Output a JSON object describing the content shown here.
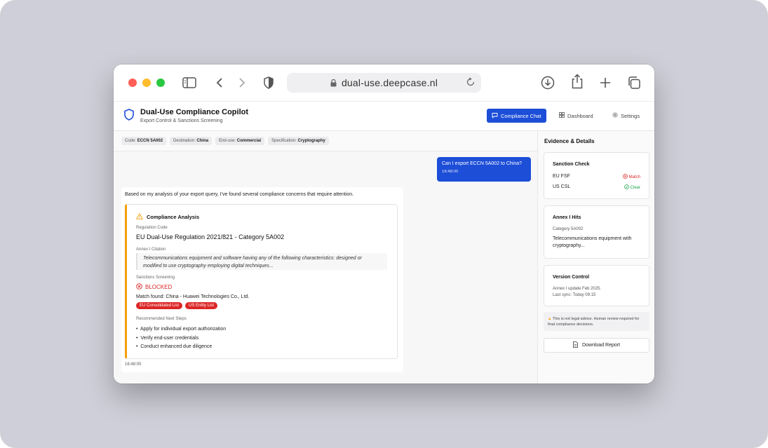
{
  "browser": {
    "url": "dual-use.deepcase.nl"
  },
  "app": {
    "title": "Dual-Use Compliance Copilot",
    "subtitle": "Export Control & Sanctions Screening"
  },
  "nav": {
    "chat": "Compliance Chat",
    "dashboard": "Dashboard",
    "settings": "Settings"
  },
  "chips": [
    {
      "key": "Code:",
      "value": "ECCN 5A002"
    },
    {
      "key": "Destination:",
      "value": "China"
    },
    {
      "key": "End-use:",
      "value": "Commercial"
    },
    {
      "key": "Specification:",
      "value": "Cryptography"
    }
  ],
  "user_message": {
    "text": "Can I export ECCN 5A002 to China?",
    "time": "16:48:00"
  },
  "ai_message": {
    "intro": "Based on my analysis of your export query, I've found several compliance concerns that require attention.",
    "time": "16:48:00",
    "analysis": {
      "title": "Compliance Analysis",
      "reg_label": "Regulation Code",
      "reg_value": "EU Dual-Use Regulation 2021/821 - Category 5A002",
      "cite_label": "Annex I Citation",
      "cite_text": "Telecommunications equipment and software having any of the following characteristics: designed or modified to use cryptography employing digital techniques...",
      "sanctions_label": "Sanctions Screening",
      "status": "BLOCKED",
      "match": "Match found: China - Huawei Technologies Co., Ltd.",
      "tags": [
        "EU Consolidated List",
        "US Entity List"
      ],
      "steps_label": "Recommended Next Steps",
      "steps": [
        "Apply for individual export authorization",
        "Verify end-user credentials",
        "Conduct enhanced due diligence"
      ]
    }
  },
  "side": {
    "title": "Evidence & Details",
    "sanction": {
      "title": "Sanction Check",
      "rows": [
        {
          "name": "EU FSF",
          "status": "Match",
          "color": "#dc2626"
        },
        {
          "name": "US CSL",
          "status": "Clear",
          "color": "#16a34a"
        }
      ]
    },
    "annex": {
      "title": "Annex I Hits",
      "category": "Category 5A002",
      "desc": "Telecommunications equipment with cryptography..."
    },
    "version": {
      "title": "Version Control",
      "line1": "Annex I update Feb 2025.",
      "line2": "Last sync: Today 09:15"
    },
    "disclaimer": "This is not legal advice. Human review required for final compliance decisions.",
    "download": "Download Report"
  },
  "colors": {
    "accent": "#1d4ed8",
    "danger": "#dc2626",
    "success": "#16a34a",
    "warning": "#f59e0b"
  }
}
